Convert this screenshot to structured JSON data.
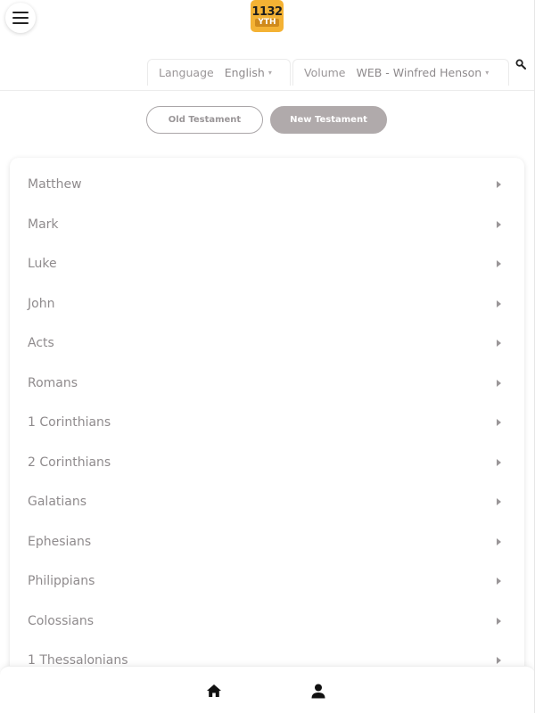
{
  "header": {
    "logo_line1": "1132",
    "logo_line2": "YTH"
  },
  "filters": {
    "language": {
      "label": "Language",
      "value": "English"
    },
    "volume": {
      "label": "Volume",
      "value": "WEB - Winfred Henson"
    }
  },
  "testament_tabs": {
    "old_label": "Old Testament",
    "new_label": "New Testament",
    "selected": "New Testament"
  },
  "books": [
    "Matthew",
    "Mark",
    "Luke",
    "John",
    "Acts",
    "Romans",
    "1 Corinthians",
    "2 Corinthians",
    "Galatians",
    "Ephesians",
    "Philippians",
    "Colossians",
    "1 Thessalonians"
  ],
  "colors": {
    "logo": "#f4b234",
    "selected_tab": "#b0aaab",
    "text": "#8f8b8d"
  },
  "icons": {
    "menu": "hamburger-icon",
    "search": "search-icon",
    "home": "home-icon",
    "profile": "person-icon",
    "row_arrow": "chevron-right-icon"
  }
}
